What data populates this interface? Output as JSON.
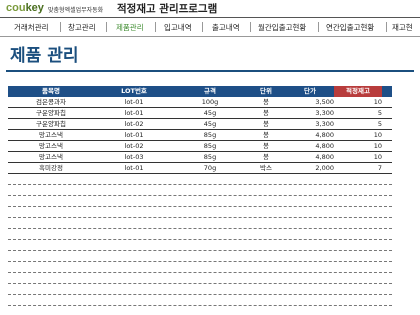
{
  "brand": {
    "logo_part1": "cou",
    "logo_part2": "key",
    "tagline": "맞춤형엑셀업무자동화",
    "app_title": "적정재고 관리프로그램"
  },
  "nav": {
    "items": [
      {
        "label": "거래처관리"
      },
      {
        "label": "창고관리"
      },
      {
        "label": "제품관리"
      },
      {
        "label": "입고내역"
      },
      {
        "label": "출고내역"
      },
      {
        "label": "월간입출고현황"
      },
      {
        "label": "연간입출고현황"
      },
      {
        "label": "재고현"
      }
    ],
    "active": "제품관리"
  },
  "page": {
    "title": "제품 관리"
  },
  "table": {
    "headers": [
      "품목명",
      "LOT번호",
      "규격",
      "단위",
      "단가",
      "적정재고"
    ],
    "rows": [
      {
        "name": "검은콩과자",
        "lot": "lot-01",
        "spec": "100g",
        "unit": "봉",
        "price": "3,500",
        "stock": "10"
      },
      {
        "name": "구운양파칩",
        "lot": "lot-01",
        "spec": "45g",
        "unit": "봉",
        "price": "3,300",
        "stock": "5"
      },
      {
        "name": "구운양파칩",
        "lot": "lot-02",
        "spec": "45g",
        "unit": "봉",
        "price": "3,300",
        "stock": "5"
      },
      {
        "name": "망고스낵",
        "lot": "lot-01",
        "spec": "85g",
        "unit": "봉",
        "price": "4,800",
        "stock": "10"
      },
      {
        "name": "망고스낵",
        "lot": "lot-02",
        "spec": "85g",
        "unit": "봉",
        "price": "4,800",
        "stock": "10"
      },
      {
        "name": "망고스낵",
        "lot": "lot-03",
        "spec": "85g",
        "unit": "봉",
        "price": "4,800",
        "stock": "10"
      },
      {
        "name": "흑미강정",
        "lot": "lot-01",
        "spec": "70g",
        "unit": "박스",
        "price": "2,000",
        "stock": "7"
      }
    ]
  },
  "colors": {
    "header_bg": "#1e4f87",
    "alert_header_bg": "#b83c3c",
    "title_color": "#1b4f7e",
    "active_nav": "#3b8a2c",
    "logo_green": "#7a9a3b"
  }
}
